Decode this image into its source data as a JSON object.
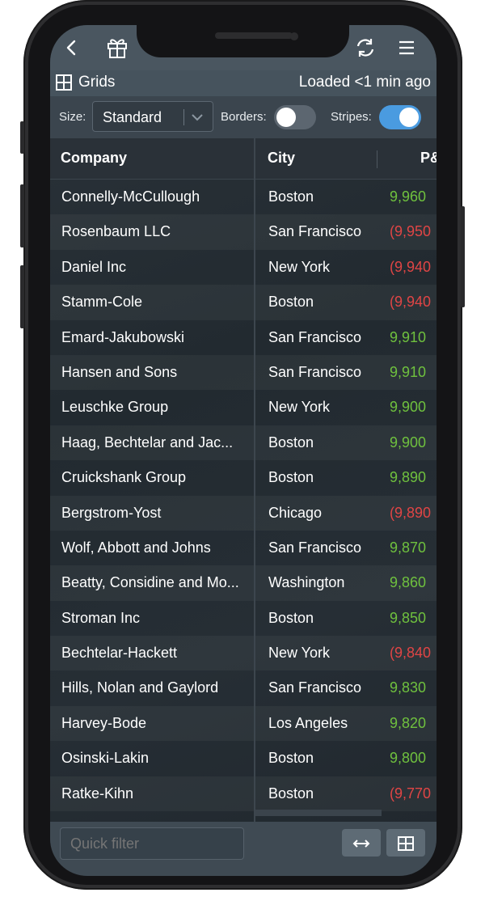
{
  "topbar": {
    "back_icon": "chevron-left-icon",
    "gift_icon": "gift-icon",
    "refresh_icon": "refresh-icon",
    "menu_icon": "hamburger-menu-icon"
  },
  "titlebar": {
    "title": "Grids",
    "status": "Loaded <1 min ago"
  },
  "controls": {
    "size_label": "Size:",
    "size_value": "Standard",
    "borders_label": "Borders:",
    "borders_on": false,
    "stripes_label": "Stripes:",
    "stripes_on": true
  },
  "grid": {
    "columns": [
      "Company",
      "City",
      "P&"
    ],
    "rows": [
      {
        "company": "Connelly-McCullough",
        "city": "Boston",
        "pl": "9,960",
        "sign": "pos"
      },
      {
        "company": "Rosenbaum LLC",
        "city": "San Francisco",
        "pl": "(9,950",
        "sign": "neg"
      },
      {
        "company": "Daniel Inc",
        "city": "New York",
        "pl": "(9,940",
        "sign": "neg"
      },
      {
        "company": "Stamm-Cole",
        "city": "Boston",
        "pl": "(9,940",
        "sign": "neg"
      },
      {
        "company": "Emard-Jakubowski",
        "city": "San Francisco",
        "pl": "9,910",
        "sign": "pos"
      },
      {
        "company": "Hansen and Sons",
        "city": "San Francisco",
        "pl": "9,910",
        "sign": "pos"
      },
      {
        "company": "Leuschke Group",
        "city": "New York",
        "pl": "9,900",
        "sign": "pos"
      },
      {
        "company": "Haag, Bechtelar and Jac...",
        "city": "Boston",
        "pl": "9,900",
        "sign": "pos"
      },
      {
        "company": "Cruickshank Group",
        "city": "Boston",
        "pl": "9,890",
        "sign": "pos"
      },
      {
        "company": "Bergstrom-Yost",
        "city": "Chicago",
        "pl": "(9,890",
        "sign": "neg"
      },
      {
        "company": "Wolf, Abbott and Johns",
        "city": "San Francisco",
        "pl": "9,870",
        "sign": "pos"
      },
      {
        "company": "Beatty, Considine and Mo...",
        "city": "Washington",
        "pl": "9,860",
        "sign": "pos"
      },
      {
        "company": "Stroman Inc",
        "city": "Boston",
        "pl": "9,850",
        "sign": "pos"
      },
      {
        "company": "Bechtelar-Hackett",
        "city": "New York",
        "pl": "(9,840",
        "sign": "neg"
      },
      {
        "company": "Hills, Nolan and Gaylord",
        "city": "San Francisco",
        "pl": "9,830",
        "sign": "pos"
      },
      {
        "company": "Harvey-Bode",
        "city": "Los Angeles",
        "pl": "9,820",
        "sign": "pos"
      },
      {
        "company": "Osinski-Lakin",
        "city": "Boston",
        "pl": "9,800",
        "sign": "pos"
      },
      {
        "company": "Ratke-Kihn",
        "city": "Boston",
        "pl": "(9,770",
        "sign": "neg"
      }
    ]
  },
  "bottom": {
    "quick_filter_placeholder": "Quick filter",
    "fit_icon": "arrows-horizontal-icon",
    "grid_icon": "grid-icon"
  },
  "colors": {
    "accent": "#4a9be0",
    "positive": "#6fc13e",
    "negative": "#e04545"
  }
}
